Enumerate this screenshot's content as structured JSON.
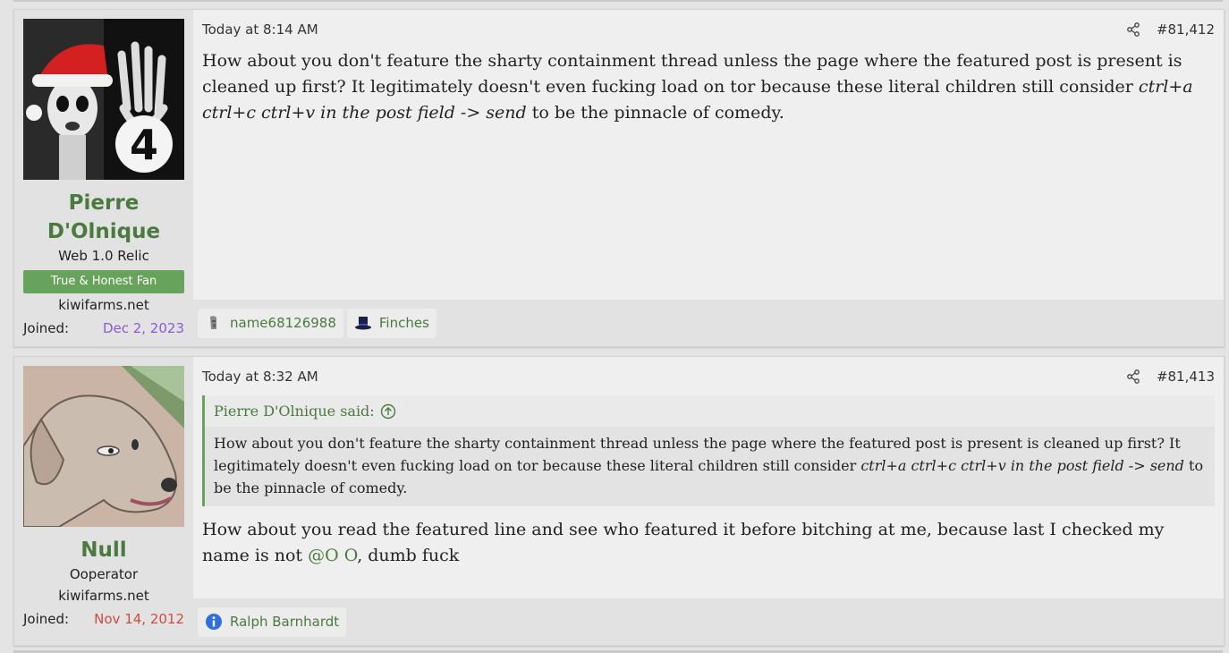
{
  "posts": [
    {
      "avatar_icon": "santa-hat-portrait-avatar",
      "username_line1": "Pierre",
      "username_line2": "D'Olnique",
      "user_title": "Web 1.0 Relic",
      "banner": "True & Honest Fan",
      "site": "kiwifarms.net",
      "joined_label": "Joined:",
      "joined_value": "Dec 2, 2023",
      "timestamp": "Today at 8:14 AM",
      "post_number": "#81,412",
      "body_part1": "How about you don't feature the sharty containment thread unless the page where the featured post is present is cleaned up first? It legitimately doesn't even fucking load on tor because these literal children still consider ",
      "body_italic": "ctrl+a ctrl+c ctrl+v in the post field -> send",
      "body_part2": " to be the pinnacle of comedy.",
      "reactions": [
        {
          "icon": "moai-icon",
          "label": "name68126988"
        },
        {
          "icon": "top-hat-icon",
          "label": "Finches"
        }
      ]
    },
    {
      "avatar_icon": "dog-avatar",
      "username": "Null",
      "user_title": "Ooperator",
      "site": "kiwifarms.net",
      "joined_label": "Joined:",
      "joined_value": "Nov 14, 2012",
      "timestamp": "Today at 8:32 AM",
      "post_number": "#81,413",
      "quote_author": "Pierre D'Olnique said:",
      "quote_part1": "How about you don't feature the sharty containment thread unless the page where the featured post is present is cleaned up first? It legitimately doesn't even fucking load on tor because these literal children still consider ",
      "quote_italic": "ctrl+a ctrl+c ctrl+v in the post field -> send",
      "quote_part2": " to be the pinnacle of comedy.",
      "body_part1": "How about you read the featured line and see who featured it before bitching at me, because last I checked my name is not ",
      "body_mention": "@O O",
      "body_part2": ", dumb fuck",
      "reactions": [
        {
          "icon": "info-icon",
          "label": "Ralph Barnhardt"
        }
      ]
    }
  ],
  "colors": {
    "accent_green": "#4b7a3f",
    "banner_green": "#67a35b",
    "joined_purple": "#8a5bd6",
    "joined_red": "#d14b3f"
  }
}
